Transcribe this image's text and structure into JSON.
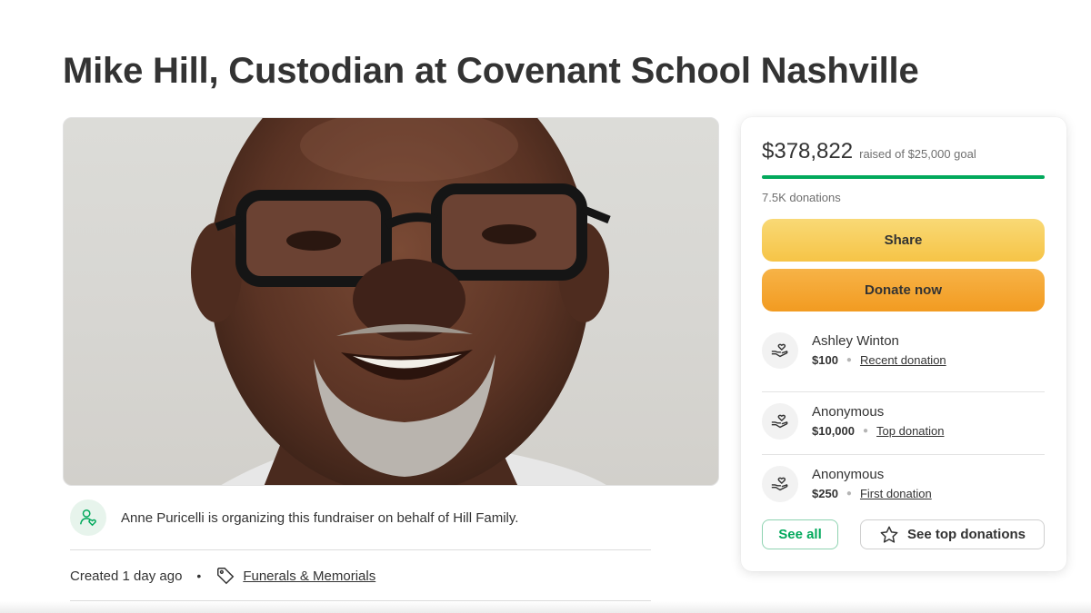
{
  "campaign": {
    "title": "Mike Hill, Custodian at Covenant School Nashville",
    "organizer_text": "Anne Puricelli is organizing this fundraiser on behalf of Hill Family.",
    "created": "Created 1 day ago",
    "meta_separator": "•",
    "category": "Funerals & Memorials"
  },
  "donation_card": {
    "raised_amount": "$378,822",
    "raised_goal_text": "raised of $25,000 goal",
    "progress_fraction": 1.0,
    "donation_count": "7.5K donations",
    "share_label": "Share",
    "donate_label": "Donate now",
    "donors": [
      {
        "name": "Ashley Winton",
        "amount": "$100",
        "type": "Recent donation"
      },
      {
        "name": "Anonymous",
        "amount": "$10,000",
        "type": "Top donation"
      },
      {
        "name": "Anonymous",
        "amount": "$250",
        "type": "First donation"
      }
    ],
    "see_all_label": "See all",
    "see_top_label": "See top donations"
  },
  "colors": {
    "brand_green": "#02a95c",
    "share_yellow": "#f6c447",
    "donate_orange": "#f29b21"
  },
  "icons": {
    "organizer_avatar": "person-heart-icon",
    "donor_avatar": "hand-heart-icon",
    "category": "tag-icon",
    "top_donations": "star-icon"
  }
}
